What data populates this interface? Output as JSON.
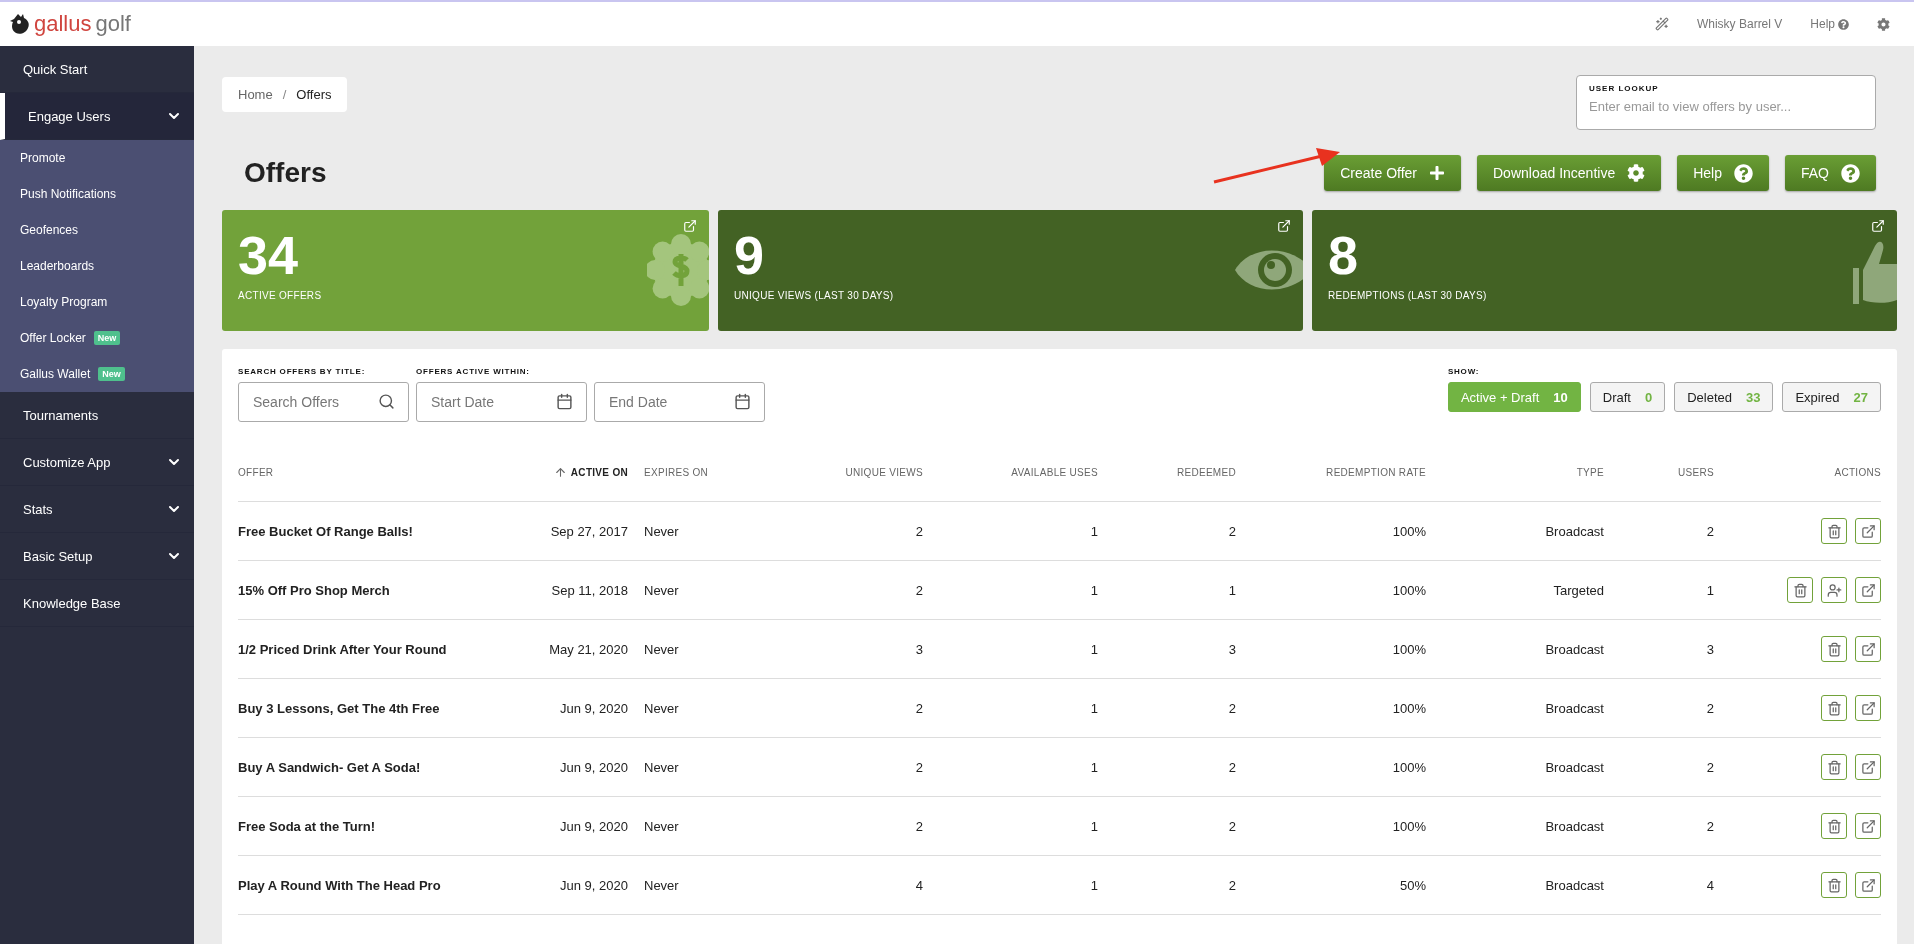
{
  "logo": {
    "first": "gallus",
    "second": "golf"
  },
  "topbar": {
    "account": "Whisky Barrel V",
    "help": "Help"
  },
  "sidebar": {
    "items": [
      {
        "label": "Quick Start",
        "kind": "link",
        "selected": false
      },
      {
        "label": "Engage Users",
        "kind": "group",
        "expanded": true,
        "selected": true,
        "children": [
          {
            "label": "Promote"
          },
          {
            "label": "Push Notifications"
          },
          {
            "label": "Geofences"
          },
          {
            "label": "Leaderboards"
          },
          {
            "label": "Loyalty Program"
          },
          {
            "label": "Offer Locker",
            "badge": "New"
          },
          {
            "label": "Gallus Wallet",
            "badge": "New"
          }
        ]
      },
      {
        "label": "Tournaments",
        "kind": "link",
        "selected": false
      },
      {
        "label": "Customize App",
        "kind": "group",
        "selected": false
      },
      {
        "label": "Stats",
        "kind": "group",
        "selected": false
      },
      {
        "label": "Basic Setup",
        "kind": "group",
        "selected": false
      },
      {
        "label": "Knowledge Base",
        "kind": "link",
        "selected": false
      }
    ]
  },
  "breadcrumb": {
    "items": [
      "Home",
      "Offers"
    ],
    "separator": "/"
  },
  "user_lookup": {
    "label": "USER LOOKUP",
    "placeholder": "Enter email to view offers by user..."
  },
  "title": "Offers",
  "actions": [
    {
      "label": "Create Offer",
      "kind": "plus"
    },
    {
      "label": "Download Incentive",
      "kind": "gear"
    },
    {
      "label": "Help",
      "kind": "question"
    },
    {
      "label": "FAQ",
      "kind": "question"
    }
  ],
  "stats": [
    {
      "value": "34",
      "label": "ACTIVE OFFERS",
      "kind": "dollar",
      "color": "#72a23a"
    },
    {
      "value": "9",
      "label": "UNIQUE VIEWS (LAST 30 DAYS)",
      "kind": "eye",
      "color": "#436224"
    },
    {
      "value": "8",
      "label": "REDEMPTIONS (LAST 30 DAYS)",
      "kind": "thumb",
      "color": "#436224"
    }
  ],
  "filters": {
    "search_label": "SEARCH OFFERS BY TITLE:",
    "search_placeholder": "Search Offers",
    "date_label": "OFFERS ACTIVE WITHIN:",
    "start_placeholder": "Start Date",
    "end_placeholder": "End Date",
    "show_label": "SHOW:",
    "show": [
      {
        "label": "Active + Draft",
        "count": "10",
        "selected": true
      },
      {
        "label": "Draft",
        "count": "0",
        "selected": false
      },
      {
        "label": "Deleted",
        "count": "33",
        "selected": false
      },
      {
        "label": "Expired",
        "count": "27",
        "selected": false
      }
    ]
  },
  "table": {
    "columns": [
      {
        "label": "OFFER",
        "sorted": false
      },
      {
        "label": "ACTIVE ON",
        "sorted": true
      },
      {
        "label": "EXPIRES ON",
        "sorted": false
      },
      {
        "label": "UNIQUE VIEWS",
        "sorted": false
      },
      {
        "label": "AVAILABLE USES",
        "sorted": false
      },
      {
        "label": "REDEEMED",
        "sorted": false
      },
      {
        "label": "REDEMPTION RATE",
        "sorted": false
      },
      {
        "label": "TYPE",
        "sorted": false
      },
      {
        "label": "USERS",
        "sorted": false
      },
      {
        "label": "ACTIONS",
        "sorted": false
      }
    ],
    "rows": [
      {
        "cells": [
          "Free Bucket Of Range Balls!",
          "Sep 27, 2017",
          "Never",
          "2",
          "1",
          "2",
          "100%",
          "Broadcast",
          "2"
        ],
        "targeted": false
      },
      {
        "cells": [
          "15% Off Pro Shop Merch",
          "Sep 11, 2018",
          "Never",
          "2",
          "1",
          "1",
          "100%",
          "Targeted",
          "1"
        ],
        "targeted": true
      },
      {
        "cells": [
          "1/2 Priced Drink After Your Round",
          "May 21, 2020",
          "Never",
          "3",
          "1",
          "3",
          "100%",
          "Broadcast",
          "3"
        ],
        "targeted": false
      },
      {
        "cells": [
          "Buy 3 Lessons, Get The 4th Free",
          "Jun 9, 2020",
          "Never",
          "2",
          "1",
          "2",
          "100%",
          "Broadcast",
          "2"
        ],
        "targeted": false
      },
      {
        "cells": [
          "Buy A Sandwich- Get A Soda!",
          "Jun 9, 2020",
          "Never",
          "2",
          "1",
          "2",
          "100%",
          "Broadcast",
          "2"
        ],
        "targeted": false
      },
      {
        "cells": [
          "Free Soda at the Turn!",
          "Jun 9, 2020",
          "Never",
          "2",
          "1",
          "2",
          "100%",
          "Broadcast",
          "2"
        ],
        "targeted": false
      },
      {
        "cells": [
          "Play A Round With The Head Pro",
          "Jun 9, 2020",
          "Never",
          "4",
          "1",
          "2",
          "50%",
          "Broadcast",
          "4"
        ],
        "targeted": false
      }
    ]
  }
}
